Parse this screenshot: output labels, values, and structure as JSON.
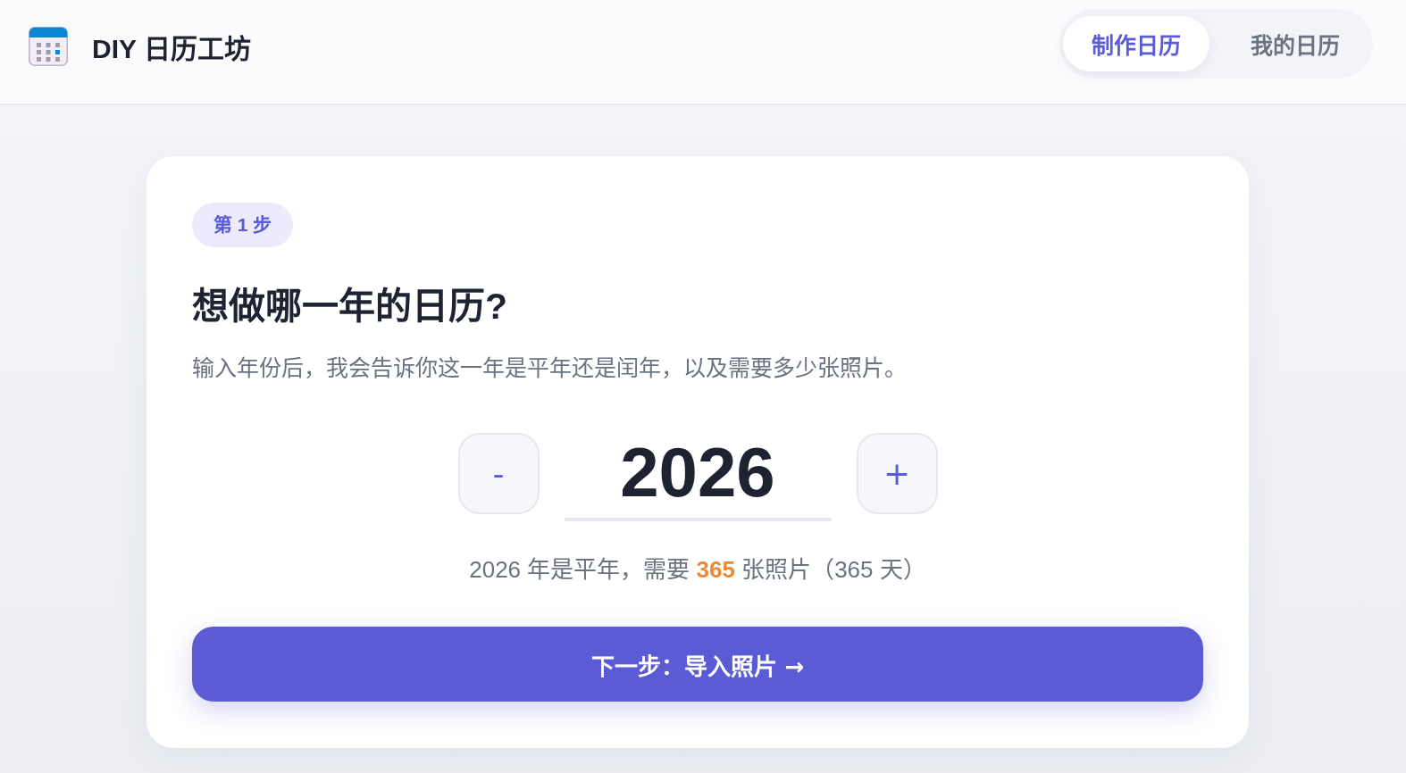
{
  "header": {
    "title": "DIY 日历工坊",
    "tabs": [
      {
        "label": "制作日历",
        "selected": true
      },
      {
        "label": "我的日历",
        "selected": false
      }
    ]
  },
  "card": {
    "step_badge": "第 1 步",
    "heading": "想做哪一年的日历?",
    "description": "输入年份后，我会告诉你这一年是平年还是闰年，以及需要多少张照片。",
    "year_picker": {
      "decrement_label": "-",
      "value": "2026",
      "increment_label": "+"
    },
    "result": "2026 年是平年，需要 **365** 张照片（365 天）",
    "next_button": "下一步：导入照片 →"
  }
}
